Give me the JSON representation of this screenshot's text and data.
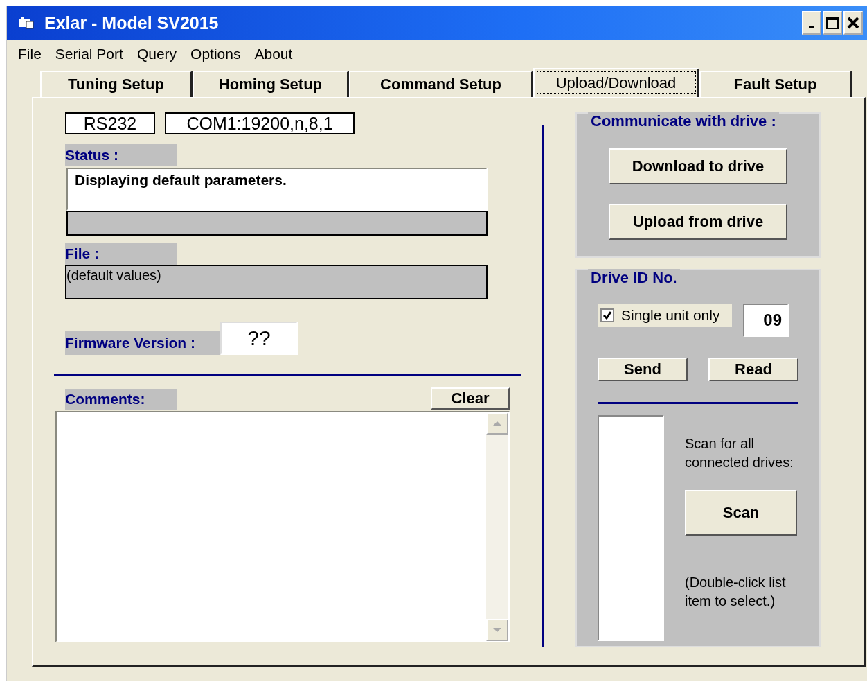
{
  "window": {
    "title": "Exlar - Model SV2015"
  },
  "menu": [
    "File",
    "Serial Port",
    "Query",
    "Options",
    "About"
  ],
  "tabs": [
    {
      "label": "Tuning Setup",
      "selected": false
    },
    {
      "label": "Homing Setup",
      "selected": false
    },
    {
      "label": "Command Setup",
      "selected": false
    },
    {
      "label": "Upload/Download",
      "selected": true
    },
    {
      "label": "Fault Setup",
      "selected": false
    }
  ],
  "connection": {
    "protocol": "RS232",
    "port_settings": "COM1:19200,n,8,1"
  },
  "status": {
    "label": "Status :",
    "message": "Displaying default parameters."
  },
  "file": {
    "label": "File :",
    "value": "(default values)"
  },
  "firmware": {
    "label": "Firmware Version :",
    "value": "??"
  },
  "comments": {
    "label": "Comments:",
    "clear_button": "Clear"
  },
  "communicate": {
    "title": "Communicate with drive :",
    "buttons": [
      "Download to drive",
      "Upload from drive"
    ]
  },
  "drive_id": {
    "title": "Drive ID No.",
    "single_unit": {
      "label": "Single unit only",
      "checked": true
    },
    "id_value": "09",
    "buttons": [
      "Send",
      "Read"
    ],
    "scan_hint": "Scan for all connected drives:",
    "scan_button": "Scan",
    "select_hint": "(Double-click list item to select.)"
  }
}
